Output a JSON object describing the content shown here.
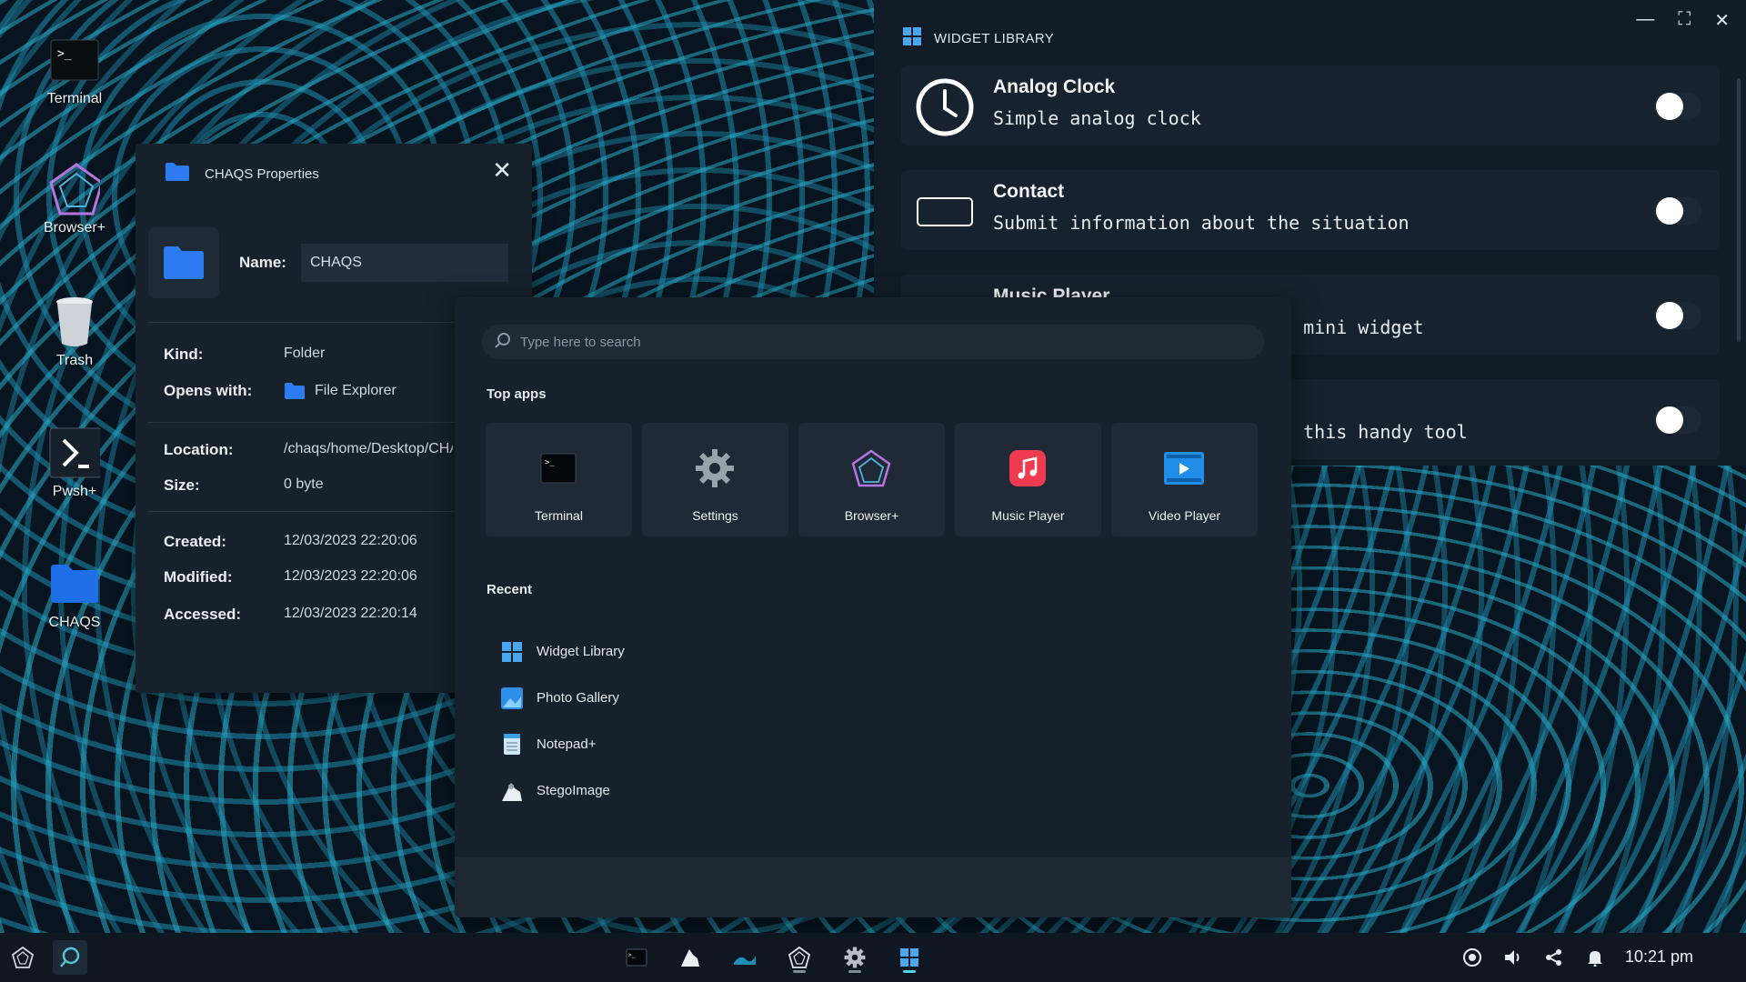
{
  "desktop": {
    "icons": [
      {
        "label": "Terminal",
        "icon": "terminal-icon"
      },
      {
        "label": "Browser+",
        "icon": "browser-icon"
      },
      {
        "label": "Trash",
        "icon": "trash-icon"
      },
      {
        "label": "Pwsh+",
        "icon": "pwsh-icon"
      },
      {
        "label": "CHAQS",
        "icon": "folder-icon"
      }
    ]
  },
  "properties": {
    "title": "CHAQS Properties",
    "name_label": "Name:",
    "name_value": "CHAQS",
    "kind_label": "Kind:",
    "kind_value": "Folder",
    "opens_label": "Opens with:",
    "opens_value": "File Explorer",
    "location_label": "Location:",
    "location_value": "/chaqs/home/Desktop/CHAQS",
    "size_label": "Size:",
    "size_value": "0 byte",
    "created_label": "Created:",
    "created_value": "12/03/2023 22:20:06",
    "modified_label": "Modified:",
    "modified_value": "12/03/2023 22:20:06",
    "accessed_label": "Accessed:",
    "accessed_value": "12/03/2023 22:20:14"
  },
  "widget_library": {
    "title": "WIDGET LIBRARY",
    "widgets": [
      {
        "title": "Analog Clock",
        "desc": "Simple analog clock",
        "icon": "clock-icon",
        "enabled": false
      },
      {
        "title": "Contact",
        "desc": "Submit information about the situation",
        "icon": "chaqs-badge-icon",
        "enabled": false
      },
      {
        "title": "Music Player",
        "desc": "s mini widget",
        "icon": "music-icon",
        "enabled": false
      },
      {
        "title": "",
        "desc": "n this handy tool",
        "icon": "",
        "enabled": false
      }
    ]
  },
  "start_menu": {
    "search_placeholder": "Type here to search",
    "top_apps_title": "Top apps",
    "top_apps": [
      {
        "label": "Terminal",
        "icon": "terminal-icon"
      },
      {
        "label": "Settings",
        "icon": "gear-icon"
      },
      {
        "label": "Browser+",
        "icon": "browser-icon"
      },
      {
        "label": "Music Player",
        "icon": "music-icon"
      },
      {
        "label": "Video Player",
        "icon": "video-icon"
      }
    ],
    "recent_title": "Recent",
    "recent": [
      {
        "label": "Widget Library",
        "icon": "widgets-icon"
      },
      {
        "label": "Photo Gallery",
        "icon": "photo-icon"
      },
      {
        "label": "Notepad+",
        "icon": "notepad-icon"
      },
      {
        "label": "StegoImage",
        "icon": "stego-icon"
      }
    ]
  },
  "taskbar": {
    "clock": "10:21 pm"
  }
}
